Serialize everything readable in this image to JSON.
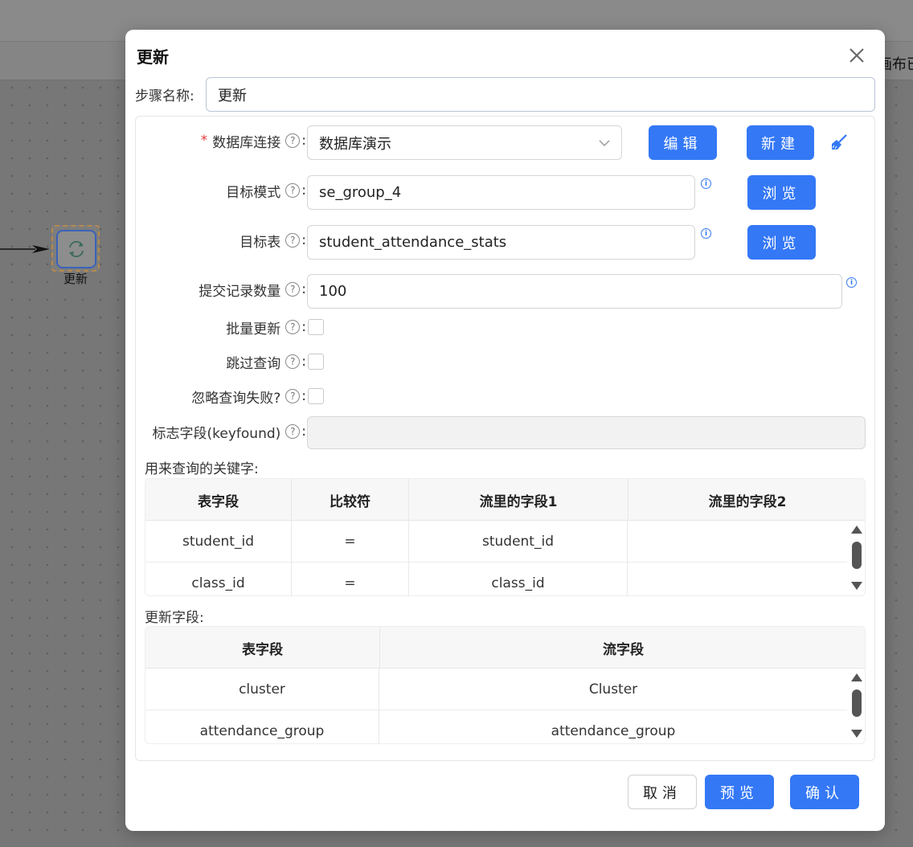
{
  "background": {
    "right_partial_text": "画布已",
    "node_label": "更新"
  },
  "dialog": {
    "title": "更新",
    "close_icon": "close-icon",
    "step_name_label": "步骤名称:",
    "step_name_value": "更新"
  },
  "form": {
    "db_connection": {
      "required_mark": "*",
      "label": "数据库连接",
      "value": "数据库演示",
      "edit_label": "编辑",
      "new_label": "新建",
      "clean_icon": "broom-icon"
    },
    "target_schema": {
      "label": "目标模式",
      "value": "se_group_4",
      "browse_label": "浏览"
    },
    "target_table": {
      "label": "目标表",
      "value": "student_attendance_stats",
      "browse_label": "浏览"
    },
    "commit_size": {
      "label": "提交记录数量",
      "value": "100"
    },
    "batch_update": {
      "label": "批量更新",
      "checked": false
    },
    "skip_lookup": {
      "label": "跳过查询",
      "checked": false
    },
    "ignore_lookup_failure": {
      "label": "忽略查询失败?",
      "checked": false
    },
    "flag_field": {
      "label": "标志字段(keyfound)",
      "value": ""
    },
    "colon": ":",
    "help": "?"
  },
  "lookup_keys": {
    "title": "用来查询的关键字:",
    "columns": [
      "表字段",
      "比较符",
      "流里的字段1",
      "流里的字段2"
    ],
    "rows": [
      [
        "student_id",
        "=",
        "student_id",
        ""
      ],
      [
        "class_id",
        "=",
        "class_id",
        ""
      ]
    ]
  },
  "update_fields": {
    "title": "更新字段:",
    "columns": [
      "表字段",
      "流字段"
    ],
    "rows": [
      [
        "cluster",
        "Cluster"
      ],
      [
        "attendance_group",
        "attendance_group"
      ]
    ]
  },
  "footer": {
    "cancel_label": "取消",
    "preview_label": "预览",
    "confirm_label": "确认"
  },
  "colors": {
    "primary": "#3478f6",
    "required": "#e4393c"
  }
}
